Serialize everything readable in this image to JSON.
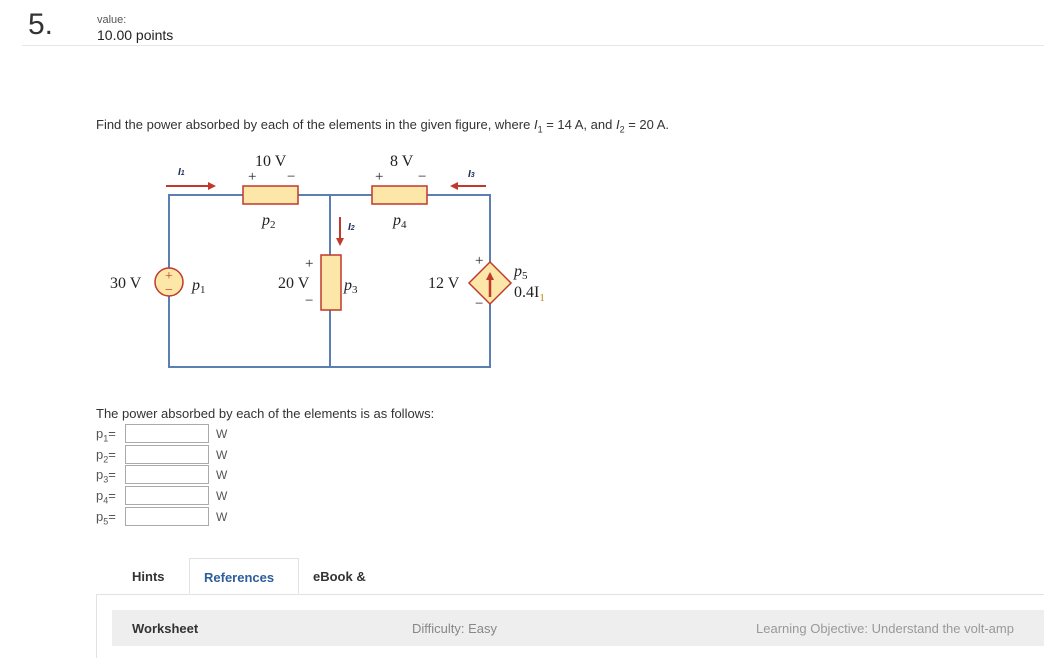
{
  "question": {
    "number": "5.",
    "value_label": "value:",
    "points": "10.00 points",
    "prompt_prefix": "Find the power absorbed by each of the elements in the given figure, where ",
    "i1_symbol": "I",
    "i1_sub": "1",
    "i1_value": " = 14 A, and ",
    "i2_symbol": "I",
    "i2_sub": "2",
    "i2_value": " = 20 A."
  },
  "circuit": {
    "source_voltage": "30 V",
    "p1": "p",
    "p1_sub": "1",
    "p2": "p",
    "p2_sub": "2",
    "p3": "p",
    "p3_sub": "3",
    "p4": "p",
    "p4_sub": "4",
    "p5": "p",
    "p5_sub": "5",
    "r2_voltage": "10 V",
    "r4_voltage": "8 V",
    "r3_voltage": "20 V",
    "dep_voltage": "12 V",
    "dep_gain": "0.4I",
    "dep_gain_sub": "1",
    "current_i1": "I",
    "current_i1_sub": "1",
    "current_i2": "I",
    "current_i2_sub": "2",
    "current_i3": "I",
    "current_i3_sub": "3",
    "plus": "+",
    "minus": "−",
    "colors": {
      "wire": "#5a7fb0",
      "element_fill": "#fde7a8",
      "element_stroke": "#c0392b",
      "arrow": "#c0392b"
    }
  },
  "answers": {
    "intro": "The power absorbed by each of the elements is as follows:",
    "rows": [
      {
        "label": "p",
        "sub": "1",
        "eq": "=",
        "value": "",
        "unit": "W"
      },
      {
        "label": "p",
        "sub": "2",
        "eq": "=",
        "value": "",
        "unit": "W"
      },
      {
        "label": "p",
        "sub": "3",
        "eq": "=",
        "value": "",
        "unit": "W"
      },
      {
        "label": "p",
        "sub": "4",
        "eq": "=",
        "value": "",
        "unit": "W"
      },
      {
        "label": "p",
        "sub": "5",
        "eq": "=",
        "value": "",
        "unit": "W"
      }
    ]
  },
  "tabs": [
    {
      "label": "Hints"
    },
    {
      "label": "References"
    },
    {
      "label": "eBook & Resources"
    }
  ],
  "worksheet": {
    "title": "Worksheet",
    "difficulty": "Difficulty: Easy",
    "objective": "Learning Objective: Understand the volt-amp"
  }
}
